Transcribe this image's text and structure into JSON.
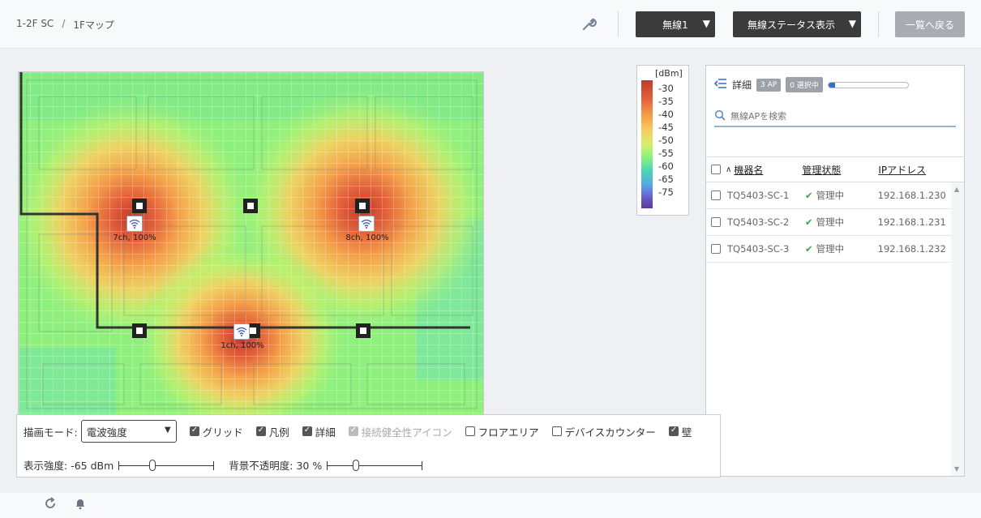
{
  "breadcrumb": {
    "site": "1-2F SC",
    "separator": "/",
    "map": "1Fマップ"
  },
  "header": {
    "radio_select": "無線1",
    "status_select": "無線ステータス表示",
    "back_button": "一覧へ戻る",
    "caret": "▼"
  },
  "legend": {
    "unit": "[dBm]",
    "ticks": [
      "-30",
      "-35",
      "-40",
      "-45",
      "-50",
      "-55",
      "-60",
      "-65",
      "-75"
    ]
  },
  "map": {
    "aps": [
      {
        "label": "7ch, 100%"
      },
      {
        "label": "8ch, 100%"
      },
      {
        "label": "1ch, 100%"
      }
    ]
  },
  "panel": {
    "detail_label": "詳細",
    "ap_badge": "3 AP",
    "selected_badge": "0 選択中",
    "progress": 0.08,
    "search_placeholder": "無線APを検索",
    "columns": {
      "sort_indicator": "∧",
      "name": "機器名",
      "status": "管理状態",
      "ip": "IPアドレス"
    },
    "rows": [
      {
        "name": "TQ5403-SC-1",
        "status": "管理中",
        "ip": "192.168.1.230"
      },
      {
        "name": "TQ5403-SC-2",
        "status": "管理中",
        "ip": "192.168.1.231"
      },
      {
        "name": "TQ5403-SC-3",
        "status": "管理中",
        "ip": "192.168.1.232"
      }
    ]
  },
  "controls": {
    "mode_label": "描画モード:",
    "mode_value": "電波強度",
    "checks": [
      {
        "label": "グリッド",
        "checked": true,
        "disabled": false
      },
      {
        "label": "凡例",
        "checked": true,
        "disabled": false
      },
      {
        "label": "詳細",
        "checked": true,
        "disabled": false
      },
      {
        "label": "接続健全性アイコン",
        "checked": true,
        "disabled": true
      },
      {
        "label": "フロアエリア",
        "checked": false,
        "disabled": false
      },
      {
        "label": "デバイスカウンター",
        "checked": false,
        "disabled": false
      },
      {
        "label": "壁",
        "checked": true,
        "disabled": false
      }
    ],
    "strength_label": "表示強度: -65 dBm",
    "strength_fraction": 0.35,
    "opacity_label": "背景不透明度: 30 %",
    "opacity_fraction": 0.3
  },
  "colors": {
    "accent": "#2f6fc4",
    "ok": "#3aa845",
    "dark": "#3b3b3b"
  }
}
